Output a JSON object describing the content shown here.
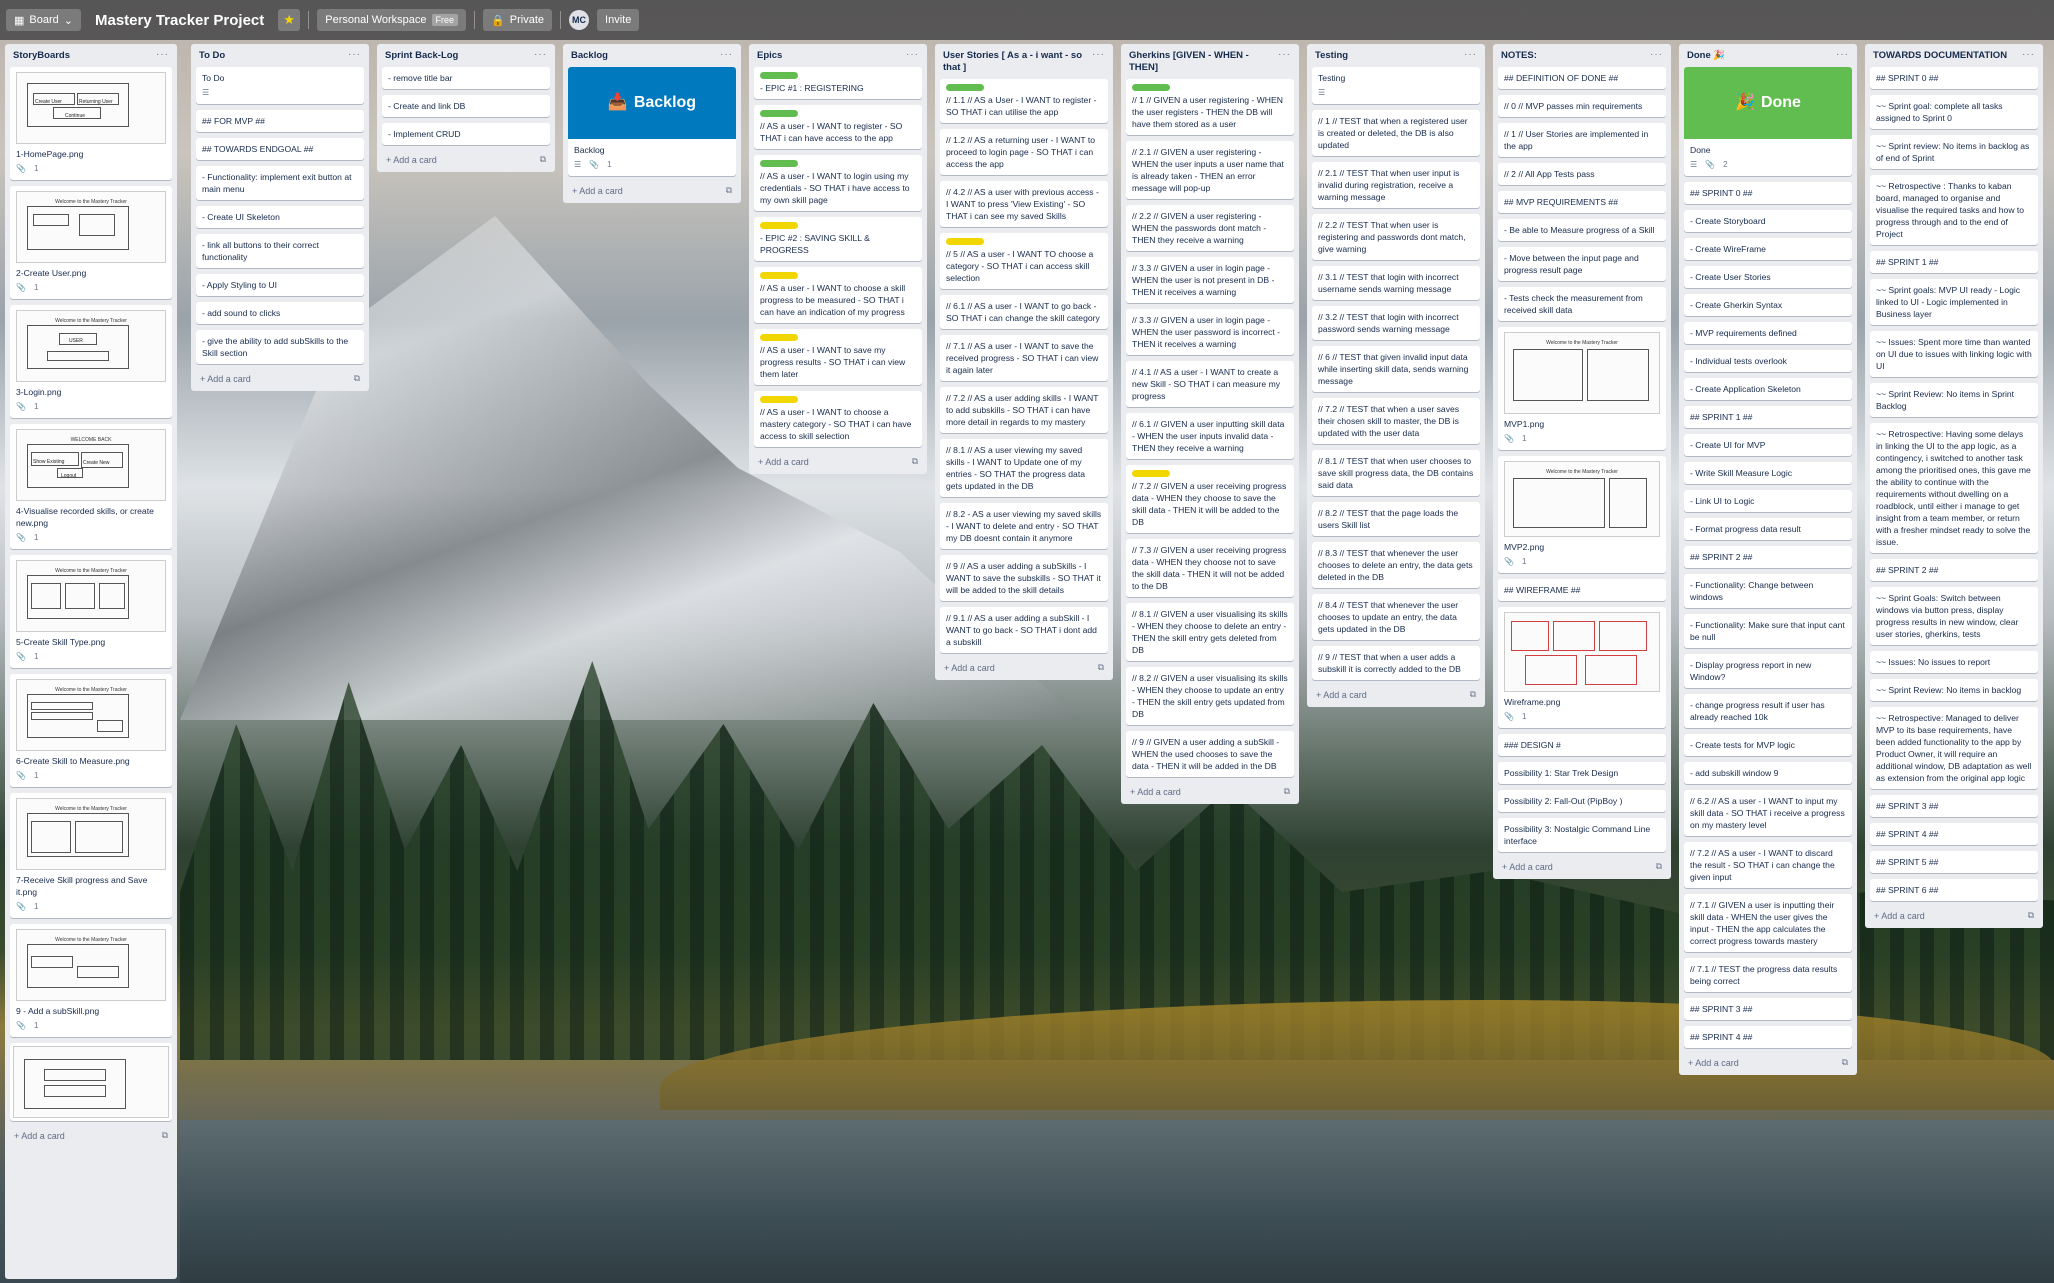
{
  "topbar": {
    "board_label": "Board",
    "title": "Mastery Tracker Project",
    "workspace": "Personal Workspace",
    "workspace_badge": "Free",
    "visibility": "Private",
    "avatar_initials": "MC",
    "invite": "Invite"
  },
  "common": {
    "add_card": "+ Add a card",
    "attachment_count": "1"
  },
  "lists": {
    "storyboards": {
      "title": "StoryBoards",
      "cards": [
        "1-HomePage.png",
        "2-Create User.png",
        "3-Login.png",
        "4-Visualise recorded skills, or create new.png",
        "5-Create Skill Type.png",
        "6-Create Skill to Measure.png",
        "7-Receive Skill progress and Save it.png",
        "9 - Add a subSkill.png"
      ],
      "thumb_titles": [
        "",
        "Welcome to the Mastery Tracker",
        "Welcome to the Mastery Tracker",
        "WELCOME BACK",
        "Welcome to the Mastery Tracker",
        "Welcome to the Mastery Tracker",
        "Welcome to the Mastery Tracker",
        "Welcome to the Mastery Tracker",
        "Welcome to the Mastery Tracker"
      ],
      "home_btns": [
        "Create User",
        "Returning User",
        "Continue"
      ],
      "user_label": "USER",
      "wb_btns": [
        "Show Existing",
        "Create New",
        "Logout"
      ]
    },
    "todo": {
      "title": "To Do",
      "cards": [
        "To Do",
        "## FOR MVP ##",
        "## TOWARDS ENDGOAL ##",
        "- Functionality: implement exit button at main menu",
        "- Create UI Skeleton",
        "- link all buttons to their correct functionality",
        "- Apply Styling to UI",
        "- add sound to clicks",
        "- give the ability to add subSkills to the Skill section"
      ]
    },
    "sprint_backlog": {
      "title": "Sprint Back-Log",
      "cards": [
        "- remove title bar",
        "- Create and link DB",
        "- Implement CRUD"
      ]
    },
    "backlog": {
      "title": "Backlog",
      "cover_text": "Backlog",
      "card_title": "Backlog",
      "cover_icon": "inbox-tray-icon"
    },
    "epics": {
      "title": "Epics",
      "cards": [
        "- EPIC #1 : REGISTERING",
        "// AS a user - I WANT to register - SO THAT i can have access to the app",
        "// AS a user - I WANT to login using my credentials - SO THAT i have access to my own skill page",
        "- EPIC #2 : SAVING SKILL & PROGRESS",
        "// AS a user - I WANT to choose a skill progress to be measured - SO THAT i can have an indication of my progress",
        "// AS a user - I WANT to save my progress results - SO THAT i can view them later",
        "// AS a user - I WANT to choose a mastery category - SO THAT i can have access to skill selection"
      ]
    },
    "user_stories": {
      "title": "User Stories [ As a - i want - so that ]",
      "cards": [
        "// 1.1 // AS a User - I WANT to register - SO THAT i can utilise the app",
        "// 1.2 // AS a returning user - I WANT to proceed to login page - SO THAT i can access the app",
        "// 4.2 // AS a user with previous access - I WANT to press 'View Existing' - SO THAT i can see my saved Skills",
        "// 5 // AS a user - I WANT TO choose a category - SO THAT i can access skill selection",
        "// 6.1 // AS a user - I WANT to go back - SO THAT i can change the skill category",
        "// 7.1 // AS a user - I WANT to save the received progress - SO THAT i can view it again later",
        "// 7.2 // AS a user adding skills - I WANT to add subskills - SO THAT i can have more detail in regards to my mastery",
        "// 8.1 // AS a user viewing my saved skills - I WANT to Update one of my entries - SO THAT the progress data gets updated in the DB",
        "// 8.2 - AS a user viewing my saved skills - I WANT to delete and entry - SO THAT my DB doesnt contain it anymore",
        "// 9 // AS a user adding a subSkills - I WANT to save the subskills - SO THAT it will be added to the skill details",
        "// 9.1 // AS a user adding a subSkill - I WANT to go back - SO THAT i dont add a subskill"
      ]
    },
    "gherkins": {
      "title": "Gherkins [GIVEN - WHEN - THEN]",
      "cards": [
        "// 1 // GIVEN a user registering - WHEN the user registers - THEN the DB will have them stored as a user",
        "// 2.1 // GIVEN a user registering - WHEN the user inputs a user name that is already taken - THEN an error message will pop-up",
        "// 2.2 // GIVEN a user registering - WHEN the passwords dont match - THEN they receive a warning",
        "// 3.3 // GIVEN a user in login page - WHEN the user is not present in DB - THEN it receives a warning",
        "// 3.3 // GIVEN a user in login page - WHEN the user password is incorrect - THEN it receives a warning",
        "// 4.1 // AS a user - I WANT to create a new Skill - SO THAT i can measure my progress",
        "// 6.1 // GIVEN a user inputting skill data - WHEN the user inputs invalid data - THEN they receive a warning",
        "// 7.2 // GIVEN a user receiving progress data - WHEN they choose to save the skill data - THEN it will be added to the DB",
        "// 7.3 // GIVEN a user receiving progress data - WHEN they choose not to save the skill data - THEN it will not be added to the DB",
        "// 8.1 // GIVEN a user visualising its skills - WHEN they choose to delete an entry - THEN the skill entry gets deleted from DB",
        "// 8.2 // GIVEN a user visualising its skills - WHEN they choose to update an entry - THEN the skill entry gets updated from DB",
        "// 9 // GIVEN a user adding a subSkill - WHEN the used chooses to save the data - THEN it will be added in the DB"
      ]
    },
    "testing": {
      "title": "Testing",
      "cards": [
        "Testing",
        "// 1 // TEST that when a registered user is created or deleted, the DB is also updated",
        "// 2.1 // TEST That when user input is invalid during registration, receive a warning message",
        "// 2.2 // TEST That when user is registering and passwords dont match, give warning",
        "// 3.1 // TEST that login with incorrect username sends warning message",
        "// 3.2 // TEST that login with incorrect password sends warning message",
        "// 6 // TEST that given invalid input data while inserting skill data, sends warning message",
        "// 7.2 // TEST that when a user saves their chosen skill to master, the DB is updated with the user data",
        "// 8.1 // TEST that when user chooses to save skill progress data, the DB contains said data",
        "// 8.2 // TEST that the page loads the users Skill list",
        "// 8.3 // TEST that whenever the user chooses to delete an entry, the data gets deleted in the DB",
        "// 8.4 // TEST that whenever the user chooses to update an entry, the data gets updated in the DB",
        "// 9 // TEST that when a user adds a subskill it is correctly added to the DB"
      ]
    },
    "notes": {
      "title": "NOTES:",
      "cards_a": [
        "## DEFINITION OF DONE ##",
        "// 0 // MVP passes min requirements",
        "// 1 // User Stories are implemented in the app",
        "// 2 // All App Tests pass",
        "## MVP REQUIREMENTS ##",
        "- Be able to Measure progress of a Skill",
        "- Move between the input page and progress result page",
        "- Tests check the measurement from received skill data"
      ],
      "mvp1": "MVP1.png",
      "mvp2": "MVP2.png",
      "wireframe_head": "## WIREFRAME ##",
      "wireframe": "Wireframe.png",
      "cards_b": [
        "### DESIGN #",
        "Possibility 1: Star Trek Design",
        "Possibility 2: Fall-Out (PipBoy )",
        "Possibility 3: Nostalgic Command Line interface"
      ],
      "mvp_thumb_title": "Welcome to the Mastery Tracker"
    },
    "done": {
      "title": "Done 🎉",
      "cover_text": "Done",
      "card_title": "Done",
      "attachments": "2",
      "cards": [
        "## SPRINT 0 ##",
        "- Create Storyboard",
        "- Create WireFrame",
        "- Create User Stories",
        "- Create Gherkin Syntax",
        "- MVP requirements defined",
        "- Individual tests overlook",
        "- Create Application Skeleton",
        "## SPRINT 1 ##",
        "- Create UI for MVP",
        "- Write Skill Measure Logic",
        "- Link UI to Logic",
        "- Format progress data result",
        "## SPRINT 2 ##",
        "- Functionality: Change between windows",
        "- Functionality: Make sure that input cant be null",
        "- Display progress report in new Window?",
        "- change progress result if user has already reached 10k",
        "- Create tests for MVP logic",
        "- add subskill window 9",
        "// 6.2 // AS a user - I WANT to input my skill data - SO THAT i receive a progress on my mastery level",
        "// 7.2 // AS a user - I WANT to discard the result - SO THAT i can change the given input",
        "// 7.1 // GIVEN a user is inputting their skill data - WHEN the user gives the input - THEN the app calculates the correct progress towards mastery",
        "// 7.1 // TEST the progress data results being correct",
        "## SPRINT 3 ##",
        "## SPRINT 4 ##"
      ]
    },
    "documentation": {
      "title": "TOWARDS DOCUMENTATION",
      "cards": [
        "## SPRINT 0 ##",
        "~~ Sprint goal: complete all tasks assigned to Sprint 0",
        "~~ Sprint review: No items in backlog as of end of Sprint",
        "~~ Retrospective : Thanks to kaban board, managed to organise and visualise the required tasks and how to progress through and to the end of Project",
        "## SPRINT 1 ##",
        "~~ Sprint goals: MVP UI ready - Logic linked to UI - Logic implemented in Business layer",
        "~~ Issues: Spent more time than wanted on UI due to issues with linking logic with UI",
        "~~ Sprint Review: No items in Sprint Backlog",
        "~~ Retrospective: Having some delays in linking the UI to the app logic, as a contingency, i switched to another task among the prioritised ones, this gave me the ability to continue with the requirements without dwelling on a roadblock, until either i manage to get insight from a team member, or return with a fresher mindset ready to solve the issue.",
        "## SPRINT 2 ##",
        "~~ Sprint Goals: Switch between windows via button press, display progress results in new window, clear user stories, gherkins, tests",
        "~~ Issues: No issues to report",
        "~~ Sprint Review: No items in backlog",
        "~~ Retrospective: Managed to deliver MVP to its base requirements, have been added functionality to the app by Product Owner, it will require an additional window, DB adaptation as well as extension from the original app logic",
        "## SPRINT 3 ##",
        "## SPRINT 4 ##",
        "## SPRINT 5 ##",
        "## SPRINT 6 ##"
      ]
    }
  },
  "colors": {
    "green_label": "#61bd4f",
    "yellow_label": "#f2d600",
    "backlog_cover": "#0079bf",
    "done_cover": "#61bd4f",
    "list_bg": "#ebecf0"
  }
}
